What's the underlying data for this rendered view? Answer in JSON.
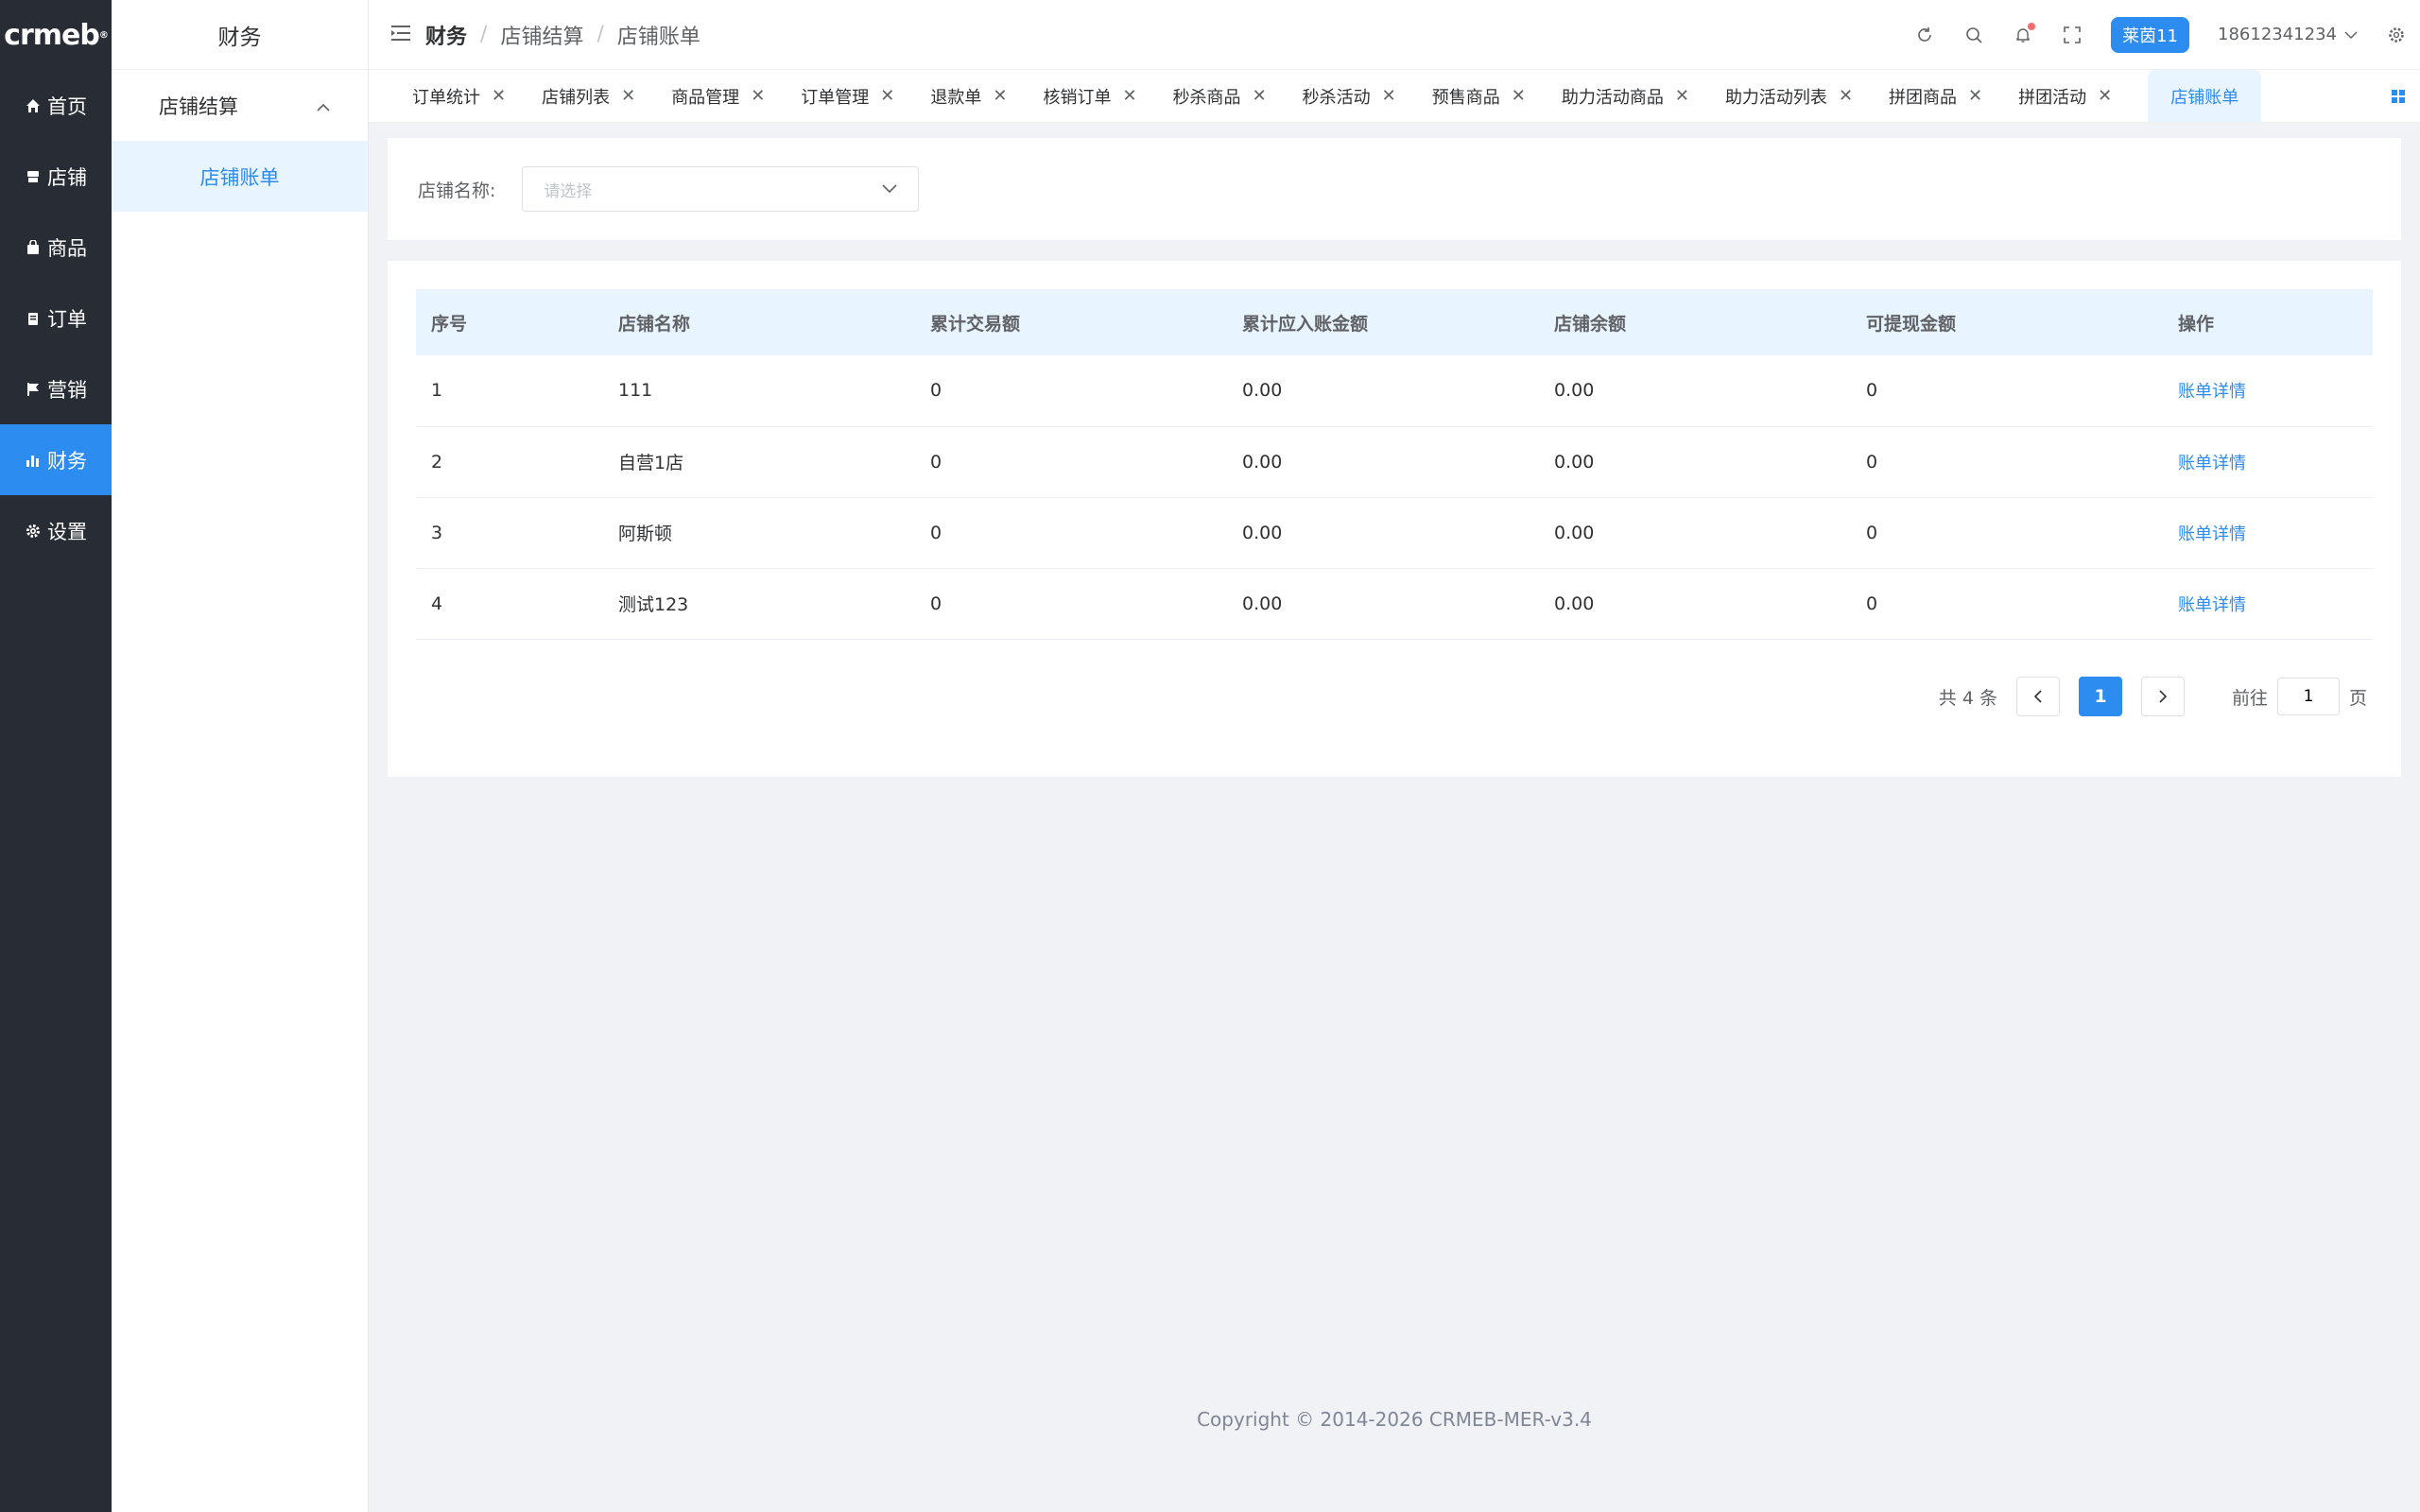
{
  "app": {
    "logo_text": "crmeb",
    "logo_mark": "®"
  },
  "rail": {
    "items": [
      {
        "label": "首页",
        "icon": "home-icon"
      },
      {
        "label": "店铺",
        "icon": "store-icon"
      },
      {
        "label": "商品",
        "icon": "bag-icon"
      },
      {
        "label": "订单",
        "icon": "clipboard-icon"
      },
      {
        "label": "营销",
        "icon": "flag-icon"
      },
      {
        "label": "财务",
        "icon": "bar-chart-icon",
        "active": true
      },
      {
        "label": "设置",
        "icon": "gear-icon"
      }
    ]
  },
  "submenu": {
    "title": "财务",
    "group_label": "店铺结算",
    "item_label": "店铺账单"
  },
  "header": {
    "breadcrumb": [
      "财务",
      "店铺结算",
      "店铺账单"
    ],
    "shop_badge": "莱茵11",
    "username": "18612341234"
  },
  "tabs": [
    "订单统计",
    "店铺列表",
    "商品管理",
    "订单管理",
    "退款单",
    "核销订单",
    "秒杀商品",
    "秒杀活动",
    "预售商品",
    "助力活动商品",
    "助力活动列表",
    "拼团商品",
    "拼团活动",
    "店铺账单"
  ],
  "filter": {
    "label": "店铺名称:",
    "placeholder": "请选择"
  },
  "table": {
    "headers": [
      "序号",
      "店铺名称",
      "累计交易额",
      "累计应入账金额",
      "店铺余额",
      "可提现金额",
      "操作"
    ],
    "rows": [
      [
        "1",
        "111",
        "0",
        "0.00",
        "0.00",
        "0",
        "账单详情"
      ],
      [
        "2",
        "自营1店",
        "0",
        "0.00",
        "0.00",
        "0",
        "账单详情"
      ],
      [
        "3",
        "阿斯顿",
        "0",
        "0.00",
        "0.00",
        "0",
        "账单详情"
      ],
      [
        "4",
        "测试123",
        "0",
        "0.00",
        "0.00",
        "0",
        "账单详情"
      ]
    ]
  },
  "pagination": {
    "total_text": "共 4 条",
    "current_page": "1",
    "goto_prefix": "前往",
    "goto_value": "1",
    "goto_suffix": "页"
  },
  "footer": {
    "copyright": "Copyright © 2014-2026 CRMEB-MER-v3.4"
  },
  "colors": {
    "accent": "#2d8cf0",
    "rail_bg": "#282c34",
    "page_bg": "#f0f2f5"
  }
}
